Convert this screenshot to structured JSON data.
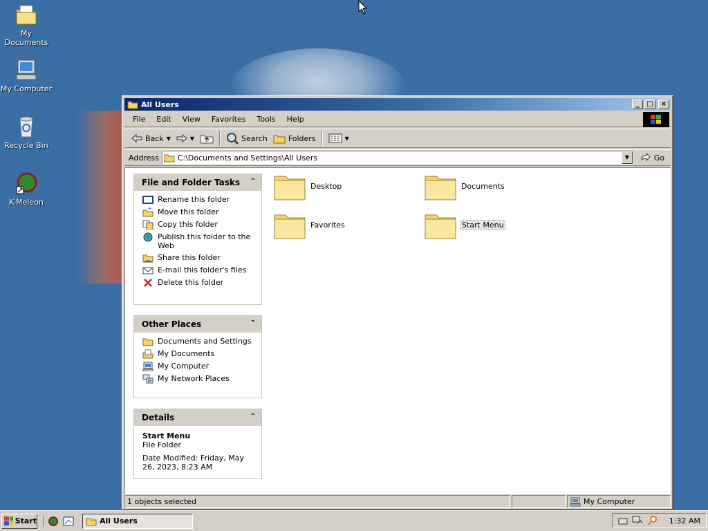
{
  "desktop": {
    "icons": [
      {
        "label": "My Documents"
      },
      {
        "label": "My Computer"
      },
      {
        "label": "Recycle Bin"
      },
      {
        "label": "K-Meleon"
      }
    ]
  },
  "window": {
    "title": "All Users",
    "controls": {
      "minimize": "_",
      "maximize": "□",
      "close": "×"
    },
    "menu": [
      "File",
      "Edit",
      "View",
      "Favorites",
      "Tools",
      "Help"
    ],
    "toolbar": {
      "back": "Back",
      "search": "Search",
      "folders": "Folders"
    },
    "address": {
      "label": "Address",
      "value": "C:\\Documents and Settings\\All Users",
      "go": "Go"
    },
    "tasks_panel": {
      "title": "File and Folder Tasks",
      "items": [
        "Rename this folder",
        "Move this folder",
        "Copy this folder",
        "Publish this folder to the Web",
        "Share this folder",
        "E-mail this folder's files",
        "Delete this folder"
      ]
    },
    "places_panel": {
      "title": "Other Places",
      "items": [
        "Documents and Settings",
        "My Documents",
        "My Computer",
        "My Network Places"
      ]
    },
    "details_panel": {
      "title": "Details",
      "name": "Start Menu",
      "type": "File Folder",
      "modified": "Date Modified: Friday, May 26, 2023, 8:23 AM"
    },
    "folders": [
      "Desktop",
      "Documents",
      "Favorites",
      "Start Menu"
    ],
    "status": {
      "left": "1 objects selected",
      "right": "My Computer"
    }
  },
  "taskbar": {
    "start": "Start",
    "active_task": "All Users",
    "clock": "1:32 AM"
  },
  "colors": {
    "desktop": "#3a6ea5",
    "titlebar": "#0a246a",
    "chrome": "#d4d0c8"
  }
}
